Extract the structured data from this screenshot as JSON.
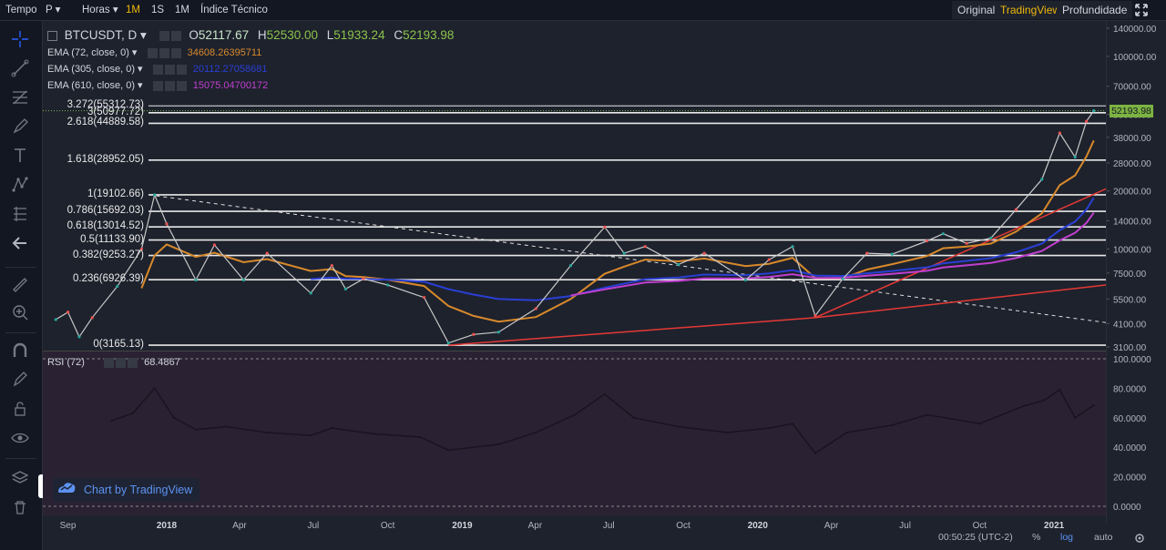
{
  "topbar": {
    "left_items": [
      {
        "label": "Tempo",
        "active": false
      },
      {
        "label": "P ▾",
        "active": false
      },
      {
        "label": "Horas ▾",
        "active": false
      },
      {
        "label": "1M",
        "active": true
      },
      {
        "label": "1S",
        "active": false
      },
      {
        "label": "1M",
        "active": false
      },
      {
        "label": "Índice Técnico",
        "active": false
      }
    ],
    "right_items": [
      {
        "label": "Original",
        "active": false
      },
      {
        "label": "TradingView",
        "active": true
      },
      {
        "label": "Profundidade",
        "active": false
      }
    ]
  },
  "legend": {
    "symbol": "BTCUSDT, D ▾",
    "o_label": "O",
    "o_value": "52117.67",
    "h_label": "H",
    "h_value": "52530.00",
    "l_label": "L",
    "l_value": "51933.24",
    "c_label": "C",
    "c_value": "52193.98",
    "ema72_label": "EMA (72, close, 0) ▾",
    "ema72_value": "34608.26395711",
    "ema305_label": "EMA (305, close, 0) ▾",
    "ema305_value": "20112.27058681",
    "ema610_label": "EMA (610, close, 0) ▾",
    "ema610_value": "15075.04700172",
    "rsi_label": "RSI (72)",
    "rsi_value": "68.4867"
  },
  "colors": {
    "ema72": "#d8892b",
    "ema305": "#2a3fd4",
    "ema610": "#c03fd0",
    "trend": "#e53935",
    "o": "#c8e6c9",
    "h": "#8bc34a",
    "l": "#8bc34a",
    "c": "#8bc34a",
    "rsi_bg": "#2a2233"
  },
  "fib_levels": [
    {
      "label": "3.272(55312.73)",
      "price": 55312.73
    },
    {
      "label": "3(50977.72)",
      "price": 50977.72
    },
    {
      "label": "2.618(44889.58)",
      "price": 44889.58
    },
    {
      "label": "1.618(28952.05)",
      "price": 28952.05
    },
    {
      "label": "1(19102.66)",
      "price": 19102.66
    },
    {
      "label": "0.786(15692.03)",
      "price": 15692.03
    },
    {
      "label": "0.618(13014.52)",
      "price": 13014.52
    },
    {
      "label": "0.5(11133.90)",
      "price": 11133.9
    },
    {
      "label": "0.382(9253.27)",
      "price": 9253.27
    },
    {
      "label": "0.236(6926.39)",
      "price": 6926.39
    },
    {
      "label": "0(3165.13)",
      "price": 3165.13
    }
  ],
  "last_price_badge": "52193.98",
  "watermark": "Chart by TradingView",
  "footer": {
    "time": "00:50:25 (UTC-2)",
    "pct": "%",
    "log": "log",
    "auto": "auto"
  },
  "chart_data": [
    {
      "type": "line",
      "title": "BTCUSDT, D",
      "scale": "log",
      "price_ticks": [
        140000,
        100000,
        70000,
        50000,
        38000,
        28000,
        20000,
        14000,
        10000,
        7500,
        5500,
        4100,
        3100
      ],
      "price_tick_labels": [
        "140000.00",
        "100000.00",
        "70000.00",
        "50000.00",
        "38000.00",
        "28000.00",
        "20000.00",
        "14000.00",
        "10000.00",
        "7500.00",
        "5500.00",
        "4100.00",
        "3100.00"
      ],
      "time_labels": [
        "Sep",
        "2018",
        "Apr",
        "Jul",
        "Oct",
        "2019",
        "Apr",
        "Jul",
        "Oct",
        "2020",
        "Apr",
        "Jul",
        "Oct",
        "2021"
      ],
      "time_label_dates": [
        "2017-09",
        "2018-01",
        "2018-04",
        "2018-07",
        "2018-10",
        "2019-01",
        "2019-04",
        "2019-07",
        "2019-10",
        "2020-01",
        "2020-04",
        "2020-07",
        "2020-10",
        "2021-01"
      ],
      "ylim": [
        3100,
        140000
      ],
      "series": [
        {
          "name": "BTCUSDT",
          "x": [
            "2017-08-17",
            "2017-09-01",
            "2017-09-15",
            "2017-10-01",
            "2017-11-01",
            "2017-12-01",
            "2017-12-17",
            "2018-01-01",
            "2018-02-06",
            "2018-03-01",
            "2018-04-06",
            "2018-05-05",
            "2018-06-28",
            "2018-07-24",
            "2018-08-10",
            "2018-09-01",
            "2018-10-01",
            "2018-11-15",
            "2018-12-15",
            "2019-01-15",
            "2019-02-15",
            "2019-04-02",
            "2019-05-15",
            "2019-06-26",
            "2019-07-20",
            "2019-08-15",
            "2019-09-25",
            "2019-10-27",
            "2019-12-17",
            "2020-01-15",
            "2020-02-13",
            "2020-03-12",
            "2020-04-15",
            "2020-05-15",
            "2020-06-15",
            "2020-07-28",
            "2020-08-17",
            "2020-09-15",
            "2020-10-15",
            "2020-11-15",
            "2020-12-17",
            "2021-01-08",
            "2021-01-27",
            "2021-02-10",
            "2021-02-19"
          ],
          "y": [
            4300,
            4700,
            3500,
            4400,
            6400,
            10000,
            19100,
            13500,
            6900,
            10500,
            6900,
            9500,
            5900,
            8200,
            6200,
            7000,
            6500,
            5600,
            3250,
            3600,
            3700,
            4900,
            8200,
            13000,
            9500,
            10300,
            8300,
            9500,
            6900,
            8800,
            10300,
            4500,
            7000,
            9500,
            9400,
            11000,
            12000,
            10700,
            11400,
            16000,
            23000,
            40000,
            30000,
            46000,
            52193.98
          ]
        }
      ]
    },
    {
      "type": "line",
      "title": "RSI (72)",
      "ylim": [
        0,
        100
      ],
      "y_ticks": [
        0,
        20,
        40,
        60,
        80,
        100
      ],
      "y_tick_labels": [
        "0.0000",
        "20.0000",
        "40.0000",
        "60.0000",
        "80.0000",
        "100.0000"
      ],
      "series": [
        {
          "name": "RSI (72)",
          "x": [
            "2017-10-25",
            "2017-11-20",
            "2017-12-17",
            "2018-01-10",
            "2018-02-06",
            "2018-03-15",
            "2018-05-05",
            "2018-06-28",
            "2018-07-24",
            "2018-09-15",
            "2018-11-10",
            "2018-12-15",
            "2019-02-15",
            "2019-04-02",
            "2019-05-20",
            "2019-06-26",
            "2019-08-01",
            "2019-09-25",
            "2019-11-25",
            "2020-01-15",
            "2020-02-13",
            "2020-03-12",
            "2020-04-20",
            "2020-06-15",
            "2020-07-28",
            "2020-08-20",
            "2020-10-01",
            "2020-11-25",
            "2020-12-20",
            "2021-01-08",
            "2021-01-27",
            "2021-02-19"
          ],
          "y": [
            58,
            63,
            80,
            60,
            52,
            54,
            50,
            48,
            53,
            49,
            47,
            38,
            42,
            50,
            62,
            76,
            60,
            54,
            50,
            53,
            56,
            36,
            50,
            55,
            62,
            60,
            56,
            68,
            72,
            79,
            60,
            68.4867
          ]
        }
      ]
    }
  ]
}
